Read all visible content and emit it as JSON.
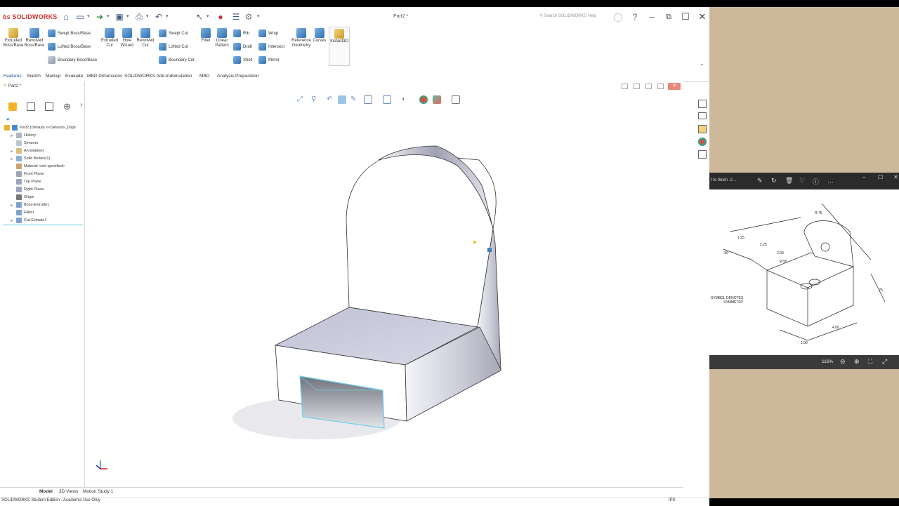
{
  "app": {
    "logo_text": "SOLIDWORKS",
    "window_title": "Part2 *",
    "search_placeholder": "Search SOLIDWORKS Help"
  },
  "ribbon": {
    "big_tools": [
      {
        "label": "Extruded\nBoss/Base"
      },
      {
        "label": "Revolved\nBoss/Base"
      },
      {
        "label": "Extruded\nCut"
      },
      {
        "label": "Hole\nWizard"
      },
      {
        "label": "Revolved\nCut"
      },
      {
        "label": "Fillet"
      },
      {
        "label": "Linear\nPattern"
      },
      {
        "label": "Reference\nGeometry"
      },
      {
        "label": "Curves"
      },
      {
        "label": "Instant3D"
      }
    ],
    "small_tools": {
      "swept_boss": "Swept Boss/Base",
      "lofted_boss": "Lofted Boss/Base",
      "boundary_boss": "Boundary Boss/Base",
      "swept_cut": "Swept Cut",
      "lofted_cut": "Lofted Cut",
      "boundary_cut": "Boundary Cut",
      "rib": "Rib",
      "draft": "Draft",
      "shell": "Shell",
      "wrap": "Wrap",
      "intersect": "Intersect",
      "mirror": "Mirror"
    }
  },
  "command_tabs": [
    "Features",
    "Sketch",
    "Markup",
    "Evaluate",
    "MBD Dimensions",
    "SOLIDWORKS Add-Ins",
    "Simulation",
    "MBD",
    "Analysis Preparation"
  ],
  "feature_tree": {
    "doc_tab": "Part2 *",
    "root": "Part2 (Default) <<Default>_Displ",
    "items": [
      {
        "label": "History",
        "expandable": true
      },
      {
        "label": "Sensors",
        "expandable": false
      },
      {
        "label": "Annotations",
        "expandable": true
      },
      {
        "label": "Solid Bodies(1)",
        "expandable": true
      },
      {
        "label": "Material <not specified>",
        "expandable": false
      },
      {
        "label": "Front Plane",
        "expandable": false
      },
      {
        "label": "Top Plane",
        "expandable": false
      },
      {
        "label": "Right Plane",
        "expandable": false
      },
      {
        "label": "Origin",
        "expandable": false
      },
      {
        "label": "Boss-Extrude1",
        "expandable": true
      },
      {
        "label": "Fillet1",
        "expandable": false
      },
      {
        "label": "Cut-Extrude1",
        "expandable": true
      }
    ]
  },
  "bottom_tabs": [
    "Model",
    "3D Views",
    "Motion Study 1"
  ],
  "status": {
    "left": "SOLIDWORKS Student Edition - Academic Use Only",
    "units": "IPS"
  },
  "pdf_viewer": {
    "title": "t to finish -2...",
    "zoom": "116%",
    "drawing_note": "SYMBOL DENOTES\nSYMMETRY",
    "dims": [
      "1.25",
      "4.00",
      "2.00",
      "R.75",
      "Ø.50",
      "2.25",
      ".50",
      "1.00",
      ".75"
    ]
  }
}
